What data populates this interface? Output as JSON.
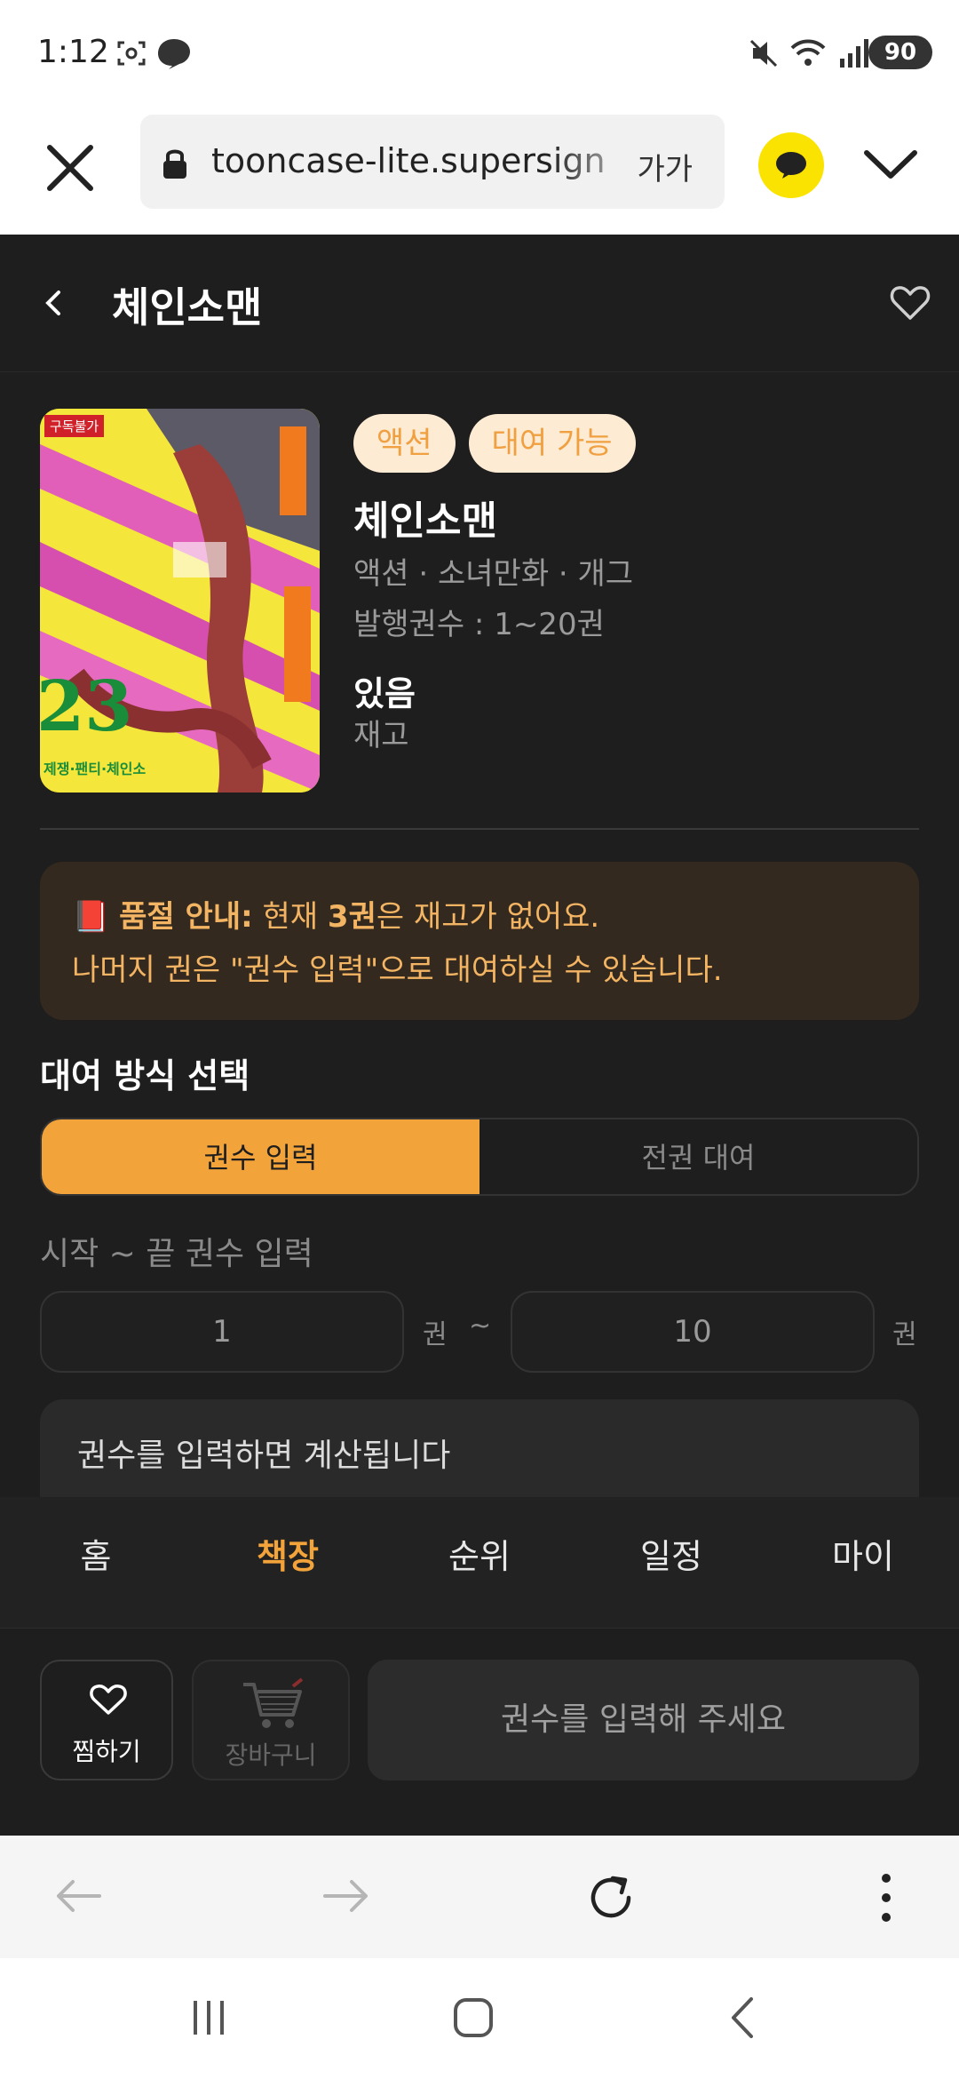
{
  "status_bar": {
    "time": "1:12",
    "battery": "90"
  },
  "browser": {
    "url": "tooncase-lite.supersign",
    "text_size_label": "가가"
  },
  "header": {
    "title": "체인소맨"
  },
  "book": {
    "badges": [
      "액션",
      "대여 가능"
    ],
    "title": "체인소맨",
    "genres": "액션 · 소녀만화 · 개그",
    "volumes": "발행권수 : 1~20권",
    "stock_value": "있음",
    "stock_label": "재고",
    "cover": {
      "tag": "구독불가",
      "volume_number": "23",
      "subtitle": "제쟁·팬티·체인소"
    }
  },
  "notice": {
    "emoji": "📕",
    "title": "품절 안내:",
    "line1_pre": " 현재 ",
    "line1_vol": "3권",
    "line1_post": "은 재고가 없어요.",
    "line2": "나머지 권은 \"권수 입력\"으로 대여하실 수 있습니다."
  },
  "rental": {
    "section_title": "대여 방식 선택",
    "options": [
      "권수 입력",
      "전권 대여"
    ],
    "selected": "권수 입력",
    "range_label": "시작 ~ 끝 권수 입력",
    "start_value": "1",
    "end_value": "10",
    "unit": "권",
    "tilde": "~",
    "calc_text": "권수를 입력하면 계산됩니다"
  },
  "bottom_nav": {
    "items": [
      "홈",
      "책장",
      "순위",
      "일정",
      "마이"
    ],
    "active": "책장"
  },
  "actions": {
    "wish_label": "찜하기",
    "cart_label": "장바구니",
    "submit_label": "권수를 입력해 주세요"
  },
  "colors": {
    "accent": "#f2a33a",
    "background": "#1e1e1e",
    "notice_bg": "#33291e",
    "kakao": "#fae300"
  }
}
